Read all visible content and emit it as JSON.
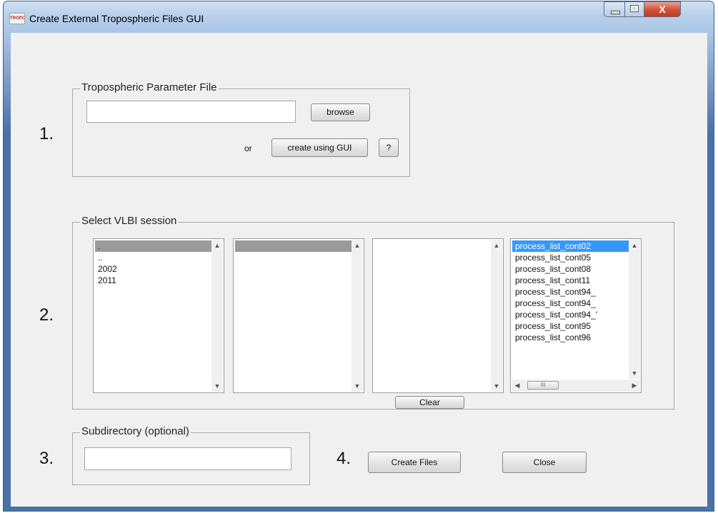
{
  "window": {
    "title": "Create External Tropospheric Files GUI",
    "app_icon_text": "TROPO",
    "controls": {
      "minimize": "minimize",
      "maximize": "maximize",
      "close": "X"
    }
  },
  "step1": {
    "number": "1.",
    "frame_title": "Tropospheric Parameter File",
    "file_input_value": "",
    "browse_label": "browse",
    "or_label": "or",
    "create_gui_label": "create using GUI",
    "help_label": "?"
  },
  "step2": {
    "number": "2.",
    "frame_title": "Select VLBI session",
    "list1": {
      "items": [
        ".",
        "..",
        "2002",
        "2011"
      ],
      "selected_index": 0
    },
    "list2": {
      "items": [
        ""
      ],
      "selected_index": 0
    },
    "list3": {
      "items": []
    },
    "list4": {
      "items": [
        "process_list_cont02",
        "process_list_cont05",
        "process_list_cont08",
        "process_list_cont11",
        "process_list_cont94_",
        "process_list_cont94_",
        "process_list_cont94_'",
        "process_list_cont95",
        "process_list_cont96"
      ],
      "selected_index": 0
    },
    "clear_label": "Clear",
    "hscroll_thumb": "III"
  },
  "step3": {
    "number": "3.",
    "frame_title": "Subdirectory (optional)",
    "subdir_value": ""
  },
  "step4": {
    "number": "4.",
    "create_files_label": "Create Files",
    "close_label": "Close"
  },
  "icons": {
    "scroll_up": "▲",
    "scroll_down": "▼",
    "scroll_left": "◀",
    "scroll_right": "▶"
  }
}
